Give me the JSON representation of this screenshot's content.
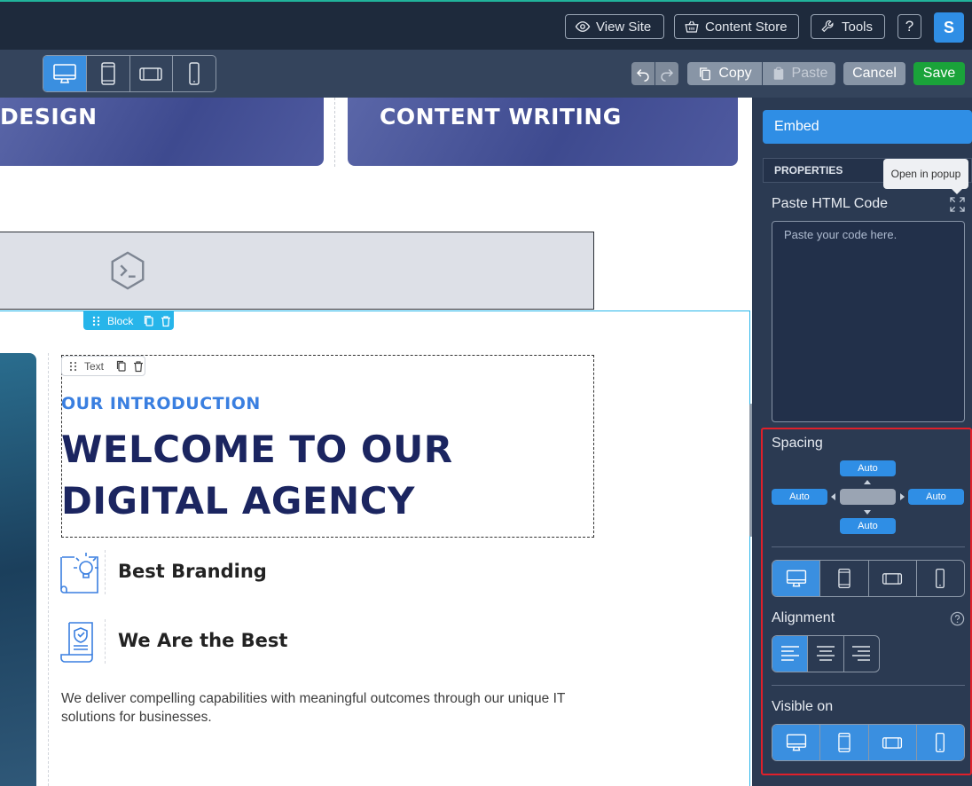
{
  "topbar": {
    "view_site": "View Site",
    "content_store": "Content Store",
    "tools": "Tools",
    "help": "?",
    "avatar_initial": "S"
  },
  "toolbar": {
    "devices": [
      "desktop",
      "tablet-portrait",
      "tablet-landscape",
      "mobile"
    ],
    "active_device": "desktop",
    "copy": "Copy",
    "paste": "Paste",
    "cancel": "Cancel",
    "save": "Save"
  },
  "canvas": {
    "card_left_title": "DESIGN",
    "card_right_title": "CONTENT WRITING",
    "block_label": "Block",
    "text_label": "Text",
    "intro": "OUR INTRODUCTION",
    "welcome": "WELCOME TO OUR DIGITAL AGENCY",
    "features": [
      {
        "title": "Best Branding",
        "icon": "lightbulb-icon"
      },
      {
        "title": "We Are the Best",
        "icon": "certificate-icon"
      }
    ],
    "description": "We deliver compelling capabilities with meaningful outcomes through our unique IT solutions for businesses."
  },
  "sidebar": {
    "tab": "Embed",
    "properties": "PROPERTIES",
    "tooltip": "Open in popup",
    "paste_html_label": "Paste HTML Code",
    "code_placeholder": "Paste your code here.",
    "spacing_label": "Spacing",
    "spacing": {
      "top": "Auto",
      "left": "Auto",
      "right": "Auto",
      "bottom": "Auto"
    },
    "alignment_label": "Alignment",
    "alignment_options": [
      "left",
      "center",
      "right"
    ],
    "active_alignment": "left",
    "visible_on_label": "Visible on"
  },
  "colors": {
    "accent": "#2f8ee5",
    "save_green": "#1aa33a",
    "highlight_red": "#e0202a",
    "selection_cyan": "#27b5ea"
  }
}
